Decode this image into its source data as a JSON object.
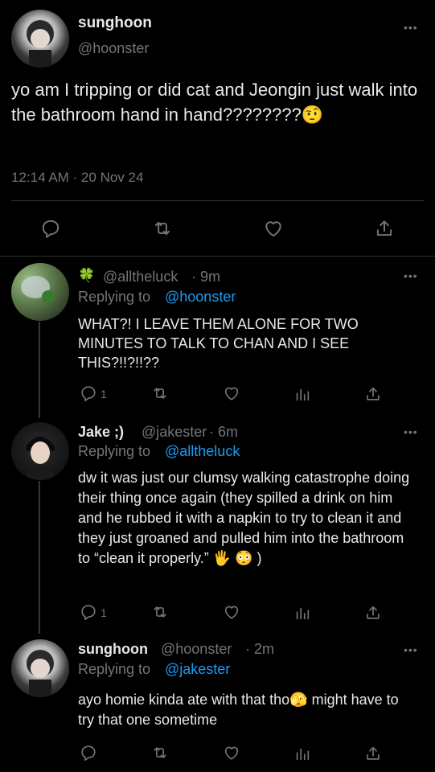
{
  "main_tweet": {
    "display_name": "sunghoon",
    "handle": "@hoonster",
    "text": "yo am I tripping or did cat and Jeongin just walk into the bathroom hand in hand????????🤨",
    "meta": "12:14 AM · 20 Nov 24"
  },
  "replies": [
    {
      "display_name": "🍀",
      "handle": "@alltheluck",
      "time": "· 9m",
      "replying_label": "Replying to",
      "replying_to": "@hoonster",
      "text": "WHAT?! I LEAVE THEM ALONE FOR TWO MINUTES TO TALK TO CHAN AND I SEE THIS?!!?!!??",
      "reply_count": "1"
    },
    {
      "display_name": "Jake ;)",
      "handle": "@jakester",
      "time": "· 6m",
      "replying_label": "Replying to",
      "replying_to": "@alltheluck",
      "text": "dw it was just our clumsy walking catastrophe doing their thing once again (they spilled a drink on him and he rubbed it with a napkin to try to clean it and they just groaned and pulled him into the bathroom to “clean it properly.” 🖐 😳 )",
      "reply_count": "1"
    },
    {
      "display_name": "sunghoon",
      "handle": "@hoonster",
      "time": "· 2m",
      "replying_label": "Replying to",
      "replying_to": "@jakester",
      "text": "ayo homie kinda ate with that tho🫣  might have to try that one sometime",
      "reply_count": ""
    }
  ],
  "colors": {
    "background": "#000000",
    "text": "#e7e9ea",
    "muted": "#71767b",
    "link": "#1d9bf0",
    "divider": "#2f3336"
  },
  "icons": [
    "more-icon",
    "reply-icon",
    "retweet-icon",
    "like-icon",
    "share-icon",
    "views-icon"
  ]
}
